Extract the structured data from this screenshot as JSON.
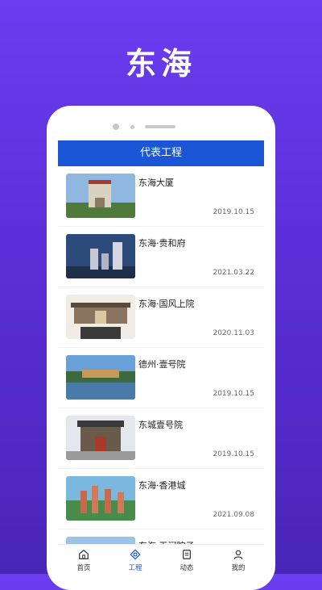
{
  "hero": {
    "title": "东海"
  },
  "header": {
    "title": "代表工程"
  },
  "projects": [
    {
      "title": "东海大厦",
      "date": "2019.10.15"
    },
    {
      "title": "东海·贵和府",
      "date": "2021.03.22"
    },
    {
      "title": "东海·国风上院",
      "date": "2020.11.03"
    },
    {
      "title": "德州·壹号院",
      "date": "2019.10.15"
    },
    {
      "title": "东城壹号院",
      "date": "2019.10.15"
    },
    {
      "title": "东海·香港城",
      "date": "2021.09.08"
    },
    {
      "title": "东海·玉河院子",
      "date": ""
    }
  ],
  "tabs": [
    {
      "label": "首页",
      "icon": "home-icon"
    },
    {
      "label": "工程",
      "icon": "project-icon",
      "active": true
    },
    {
      "label": "动态",
      "icon": "news-icon"
    },
    {
      "label": "我的",
      "icon": "user-icon"
    }
  ],
  "colors": {
    "accent": "#1a56d6",
    "background": "#5a2fd6"
  }
}
